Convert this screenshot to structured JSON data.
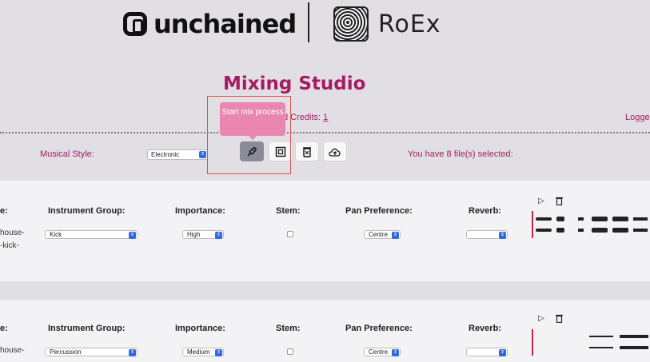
{
  "header": {
    "brand_left": "unchained",
    "brand_right": "RoEx"
  },
  "page_title": "Mixing Studio",
  "credits": {
    "label": "d Credits: ",
    "value": "1"
  },
  "logged": "Logge",
  "toolbar": {
    "style_label": "Musical Style:",
    "style_value": "Electronic",
    "tooltip_text": "Start mix process",
    "files_selected": "You have 8 file(s) selected:"
  },
  "columns": {
    "name": "e:",
    "instrument_group": "Instrument Group:",
    "importance": "Importance:",
    "stem": "Stem:",
    "pan_preference": "Pan Preference:",
    "reverb": "Reverb:"
  },
  "tracks": [
    {
      "name_line1": "house-",
      "name_line2": "-kick-",
      "instrument": "Kick",
      "importance": "High",
      "pan": "Centre",
      "reverb": ""
    },
    {
      "name_line1": "house-",
      "name_line2": "",
      "instrument": "Percussion",
      "importance": "Medium",
      "pan": "Centre",
      "reverb": ""
    }
  ],
  "icons": {
    "start_mix": "rocket-icon",
    "stop": "stop-icon",
    "delete": "trash-icon",
    "upload": "cloud-upload-icon",
    "play": "play-icon",
    "track_delete": "trash-icon"
  }
}
